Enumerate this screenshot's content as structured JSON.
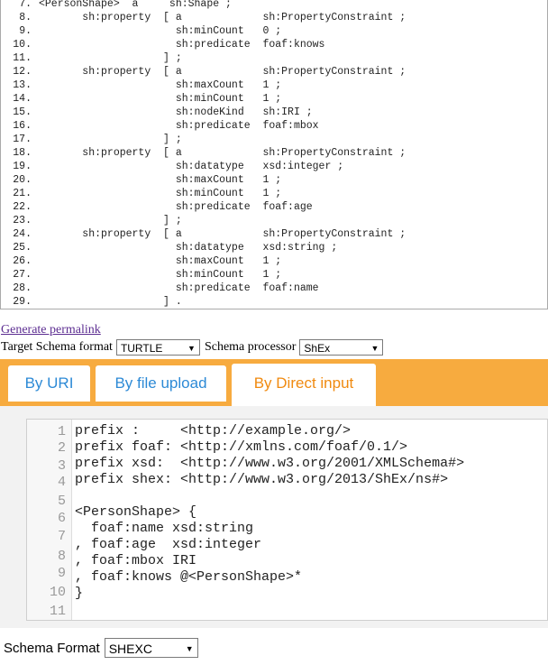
{
  "output": {
    "lines": [
      {
        "num": "7.",
        "code": "<PersonShape>  a     sh:Shape ;"
      },
      {
        "num": "8.",
        "code": "       sh:property  [ a             sh:PropertyConstraint ;"
      },
      {
        "num": "9.",
        "code": "                      sh:minCount   0 ;"
      },
      {
        "num": "10.",
        "code": "                      sh:predicate  foaf:knows"
      },
      {
        "num": "11.",
        "code": "                    ] ;"
      },
      {
        "num": "12.",
        "code": "       sh:property  [ a             sh:PropertyConstraint ;"
      },
      {
        "num": "13.",
        "code": "                      sh:maxCount   1 ;"
      },
      {
        "num": "14.",
        "code": "                      sh:minCount   1 ;"
      },
      {
        "num": "15.",
        "code": "                      sh:nodeKind   sh:IRI ;"
      },
      {
        "num": "16.",
        "code": "                      sh:predicate  foaf:mbox"
      },
      {
        "num": "17.",
        "code": "                    ] ;"
      },
      {
        "num": "18.",
        "code": "       sh:property  [ a             sh:PropertyConstraint ;"
      },
      {
        "num": "19.",
        "code": "                      sh:datatype   xsd:integer ;"
      },
      {
        "num": "20.",
        "code": "                      sh:maxCount   1 ;"
      },
      {
        "num": "21.",
        "code": "                      sh:minCount   1 ;"
      },
      {
        "num": "22.",
        "code": "                      sh:predicate  foaf:age"
      },
      {
        "num": "23.",
        "code": "                    ] ;"
      },
      {
        "num": "24.",
        "code": "       sh:property  [ a             sh:PropertyConstraint ;"
      },
      {
        "num": "25.",
        "code": "                      sh:datatype   xsd:string ;"
      },
      {
        "num": "26.",
        "code": "                      sh:maxCount   1 ;"
      },
      {
        "num": "27.",
        "code": "                      sh:minCount   1 ;"
      },
      {
        "num": "28.",
        "code": "                      sh:predicate  foaf:name"
      },
      {
        "num": "29.",
        "code": "                    ] ."
      }
    ]
  },
  "permalink_label": "Generate permalink",
  "target_format": {
    "label": "Target Schema format",
    "value": "TURTLE"
  },
  "processor": {
    "label": "Schema processor",
    "value": "ShEx"
  },
  "tabs": [
    {
      "label": "By URI",
      "active": false
    },
    {
      "label": "By file upload",
      "active": false
    },
    {
      "label": "By Direct input",
      "active": true
    }
  ],
  "editor": {
    "lines": [
      {
        "num": "1",
        "code": "prefix :     <http://example.org/>"
      },
      {
        "num": "2",
        "code": "prefix foaf: <http://xmlns.com/foaf/0.1/>"
      },
      {
        "num": "3",
        "code": "prefix xsd:  <http://www.w3.org/2001/XMLSchema#>"
      },
      {
        "num": "4",
        "code": "prefix shex: <http://www.w3.org/2013/ShEx/ns#>"
      },
      {
        "num": "5",
        "code": ""
      },
      {
        "num": "6",
        "code": "<PersonShape> {"
      },
      {
        "num": "7",
        "code": "  foaf:name xsd:string"
      },
      {
        "num": "8",
        "code": ", foaf:age  xsd:integer"
      },
      {
        "num": "9",
        "code": ", foaf:mbox IRI"
      },
      {
        "num": "10",
        "code": ", foaf:knows @<PersonShape>*"
      },
      {
        "num": "11",
        "code": "}"
      },
      {
        "num": "",
        "code": ""
      }
    ],
    "gutter_numbers": [
      "1",
      "2",
      "3",
      "4",
      "5",
      "6",
      "7",
      "8",
      "9",
      "10",
      "11"
    ]
  },
  "schema_format": {
    "label": "Schema Format",
    "value": "SHEXC"
  },
  "colors": {
    "tab_bar": "#f7ab3f",
    "tab_text": "#2d8ad6",
    "tab_active_text": "#f08a10",
    "link": "#5c2d91"
  }
}
